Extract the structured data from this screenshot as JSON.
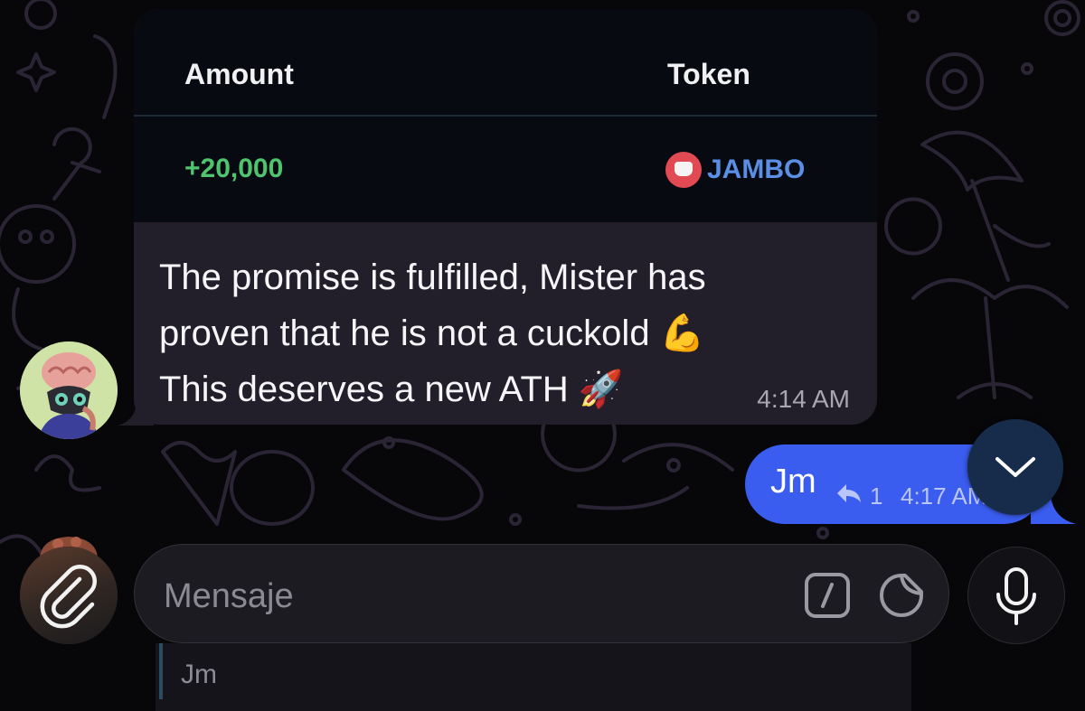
{
  "incoming_message": {
    "table": {
      "header_amount": "Amount",
      "header_token": "Token",
      "amount_value": "+20,000",
      "token_name": "JAMBO",
      "amount_color": "#4fc46e",
      "token_color": "#5b8fe6"
    },
    "text_line1": "The promise is fulfilled, Mister has",
    "text_line2": "proven that he is not a cuckold 💪",
    "text_line3": "This deserves a new ATH 🚀",
    "time": "4:14 AM"
  },
  "outgoing_message": {
    "text": "Jm",
    "reply_count": "1",
    "time": "4:17 AM",
    "bubble_color": "#3a5df0"
  },
  "composer": {
    "placeholder": "Mensaje",
    "reply_preview_text": "Jm"
  },
  "icons": {
    "attach": "paperclip-icon",
    "commands": "slash-command-icon",
    "sticker": "sticker-icon",
    "mic": "microphone-icon",
    "scroll_down": "chevron-down-icon",
    "reply": "reply-arrow-icon"
  }
}
